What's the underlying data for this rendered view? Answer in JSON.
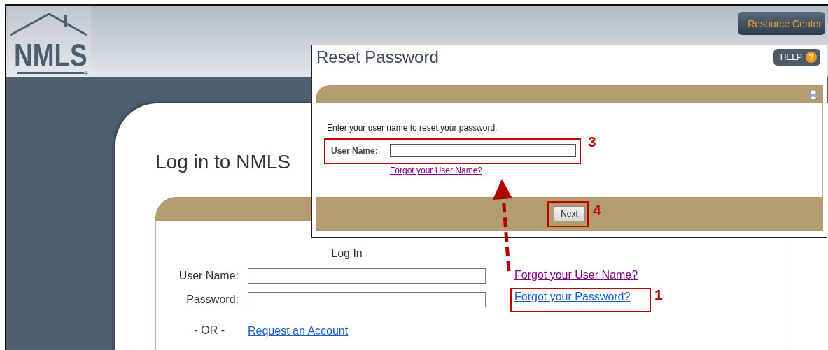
{
  "header": {
    "logo_text": "NMLS",
    "logo_mark": "®",
    "resource_button": "Resource Center"
  },
  "login": {
    "title": "Log in to NMLS",
    "heading": "Log In",
    "fields": [
      {
        "label": "User Name:"
      },
      {
        "label": "Password:"
      }
    ],
    "links": [
      {
        "text": "Forgot your User Name?",
        "visited": true
      },
      {
        "text": "Forgot your Password?",
        "visited": false
      }
    ],
    "or_text": "- OR -",
    "request_link": {
      "text": "Request an Account",
      "visited": false
    }
  },
  "dialog": {
    "title": "Reset Password",
    "help_button": "HELP",
    "help_icon": "?",
    "instruction": "Enter your user name to reset your password.",
    "field_label": "User Name:",
    "link": {
      "text": "Forgot your User Name?",
      "visited": true
    },
    "next_button": "Next"
  },
  "callouts": [
    {
      "label": "3"
    },
    {
      "label": "4"
    },
    {
      "label": "1"
    }
  ]
}
